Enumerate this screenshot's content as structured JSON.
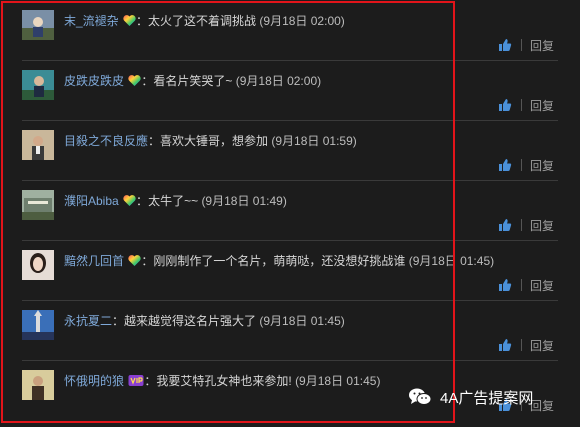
{
  "comments": [
    {
      "user": "末_流褪杂",
      "badge": "heart",
      "colon": "：",
      "text": "太火了这不着调挑战",
      "time": "(9月18日 02:00)",
      "reply": "回复"
    },
    {
      "user": "皮跌皮跌皮",
      "badge": "heart",
      "colon": "：",
      "text": "看名片笑哭了~",
      "time": "(9月18日 02:00)",
      "reply": "回复"
    },
    {
      "user": "目殺之不良反應",
      "badge": "",
      "colon": "：",
      "text": "喜欢大锤哥，想参加",
      "time": "(9月18日 01:59)",
      "reply": "回复"
    },
    {
      "user": "濮阳Abiba",
      "badge": "heart",
      "colon": "：",
      "text": "太牛了~~",
      "time": "(9月18日 01:49)",
      "reply": "回复"
    },
    {
      "user": "黯然几回首",
      "badge": "heart",
      "colon": "：",
      "text": "刚刚制作了一个名片，萌萌哒，还没想好挑战谁",
      "time": "(9月18日 01:45)",
      "reply": "回复"
    },
    {
      "user": "永抗夏二",
      "badge": "",
      "colon": "：",
      "text": "越来越觉得这名片强大了",
      "time": "(9月18日 01:45)",
      "reply": "回复"
    },
    {
      "user": "怀俄明的狼",
      "badge": "vip",
      "colon": "：",
      "text": "我要艾特孔女神也来参加!",
      "time": "(9月18日 01:45)",
      "reply": "回复"
    }
  ],
  "watermark": {
    "text": "4A广告提案网"
  },
  "colors": {
    "username": "#7fa9d9",
    "highlight_box": "#e2141a",
    "like": "#4a90d9"
  }
}
